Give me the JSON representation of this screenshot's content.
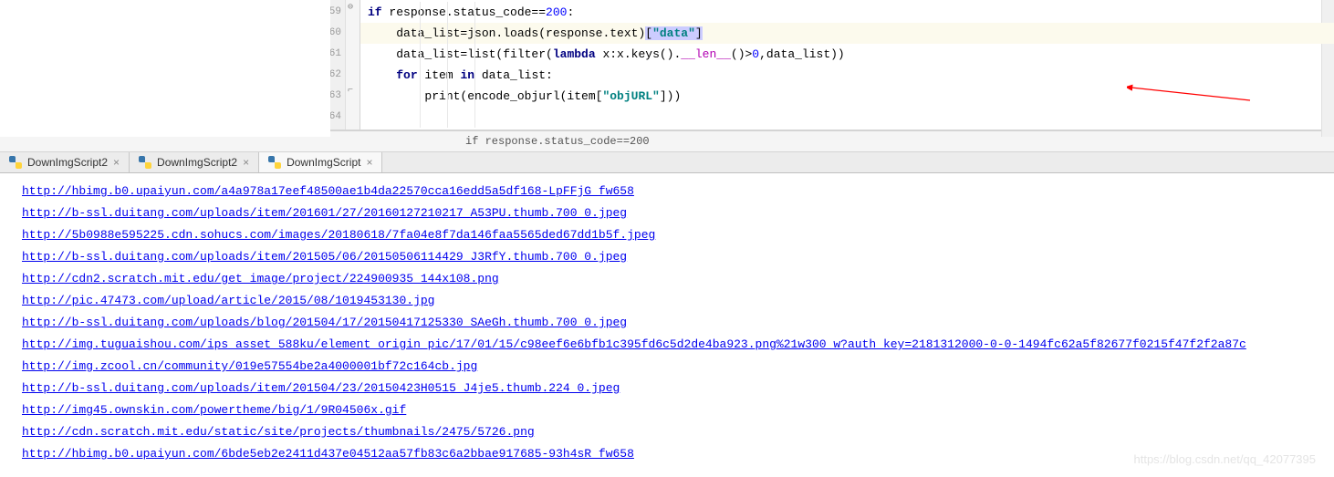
{
  "editor": {
    "lines": [
      {
        "num": "59",
        "type": "code",
        "segments": [
          {
            "t": "if",
            "c": "kw"
          },
          {
            "t": " response.status_code=="
          },
          {
            "t": "200",
            "c": "num"
          },
          {
            "t": ":"
          }
        ],
        "indent": 0
      },
      {
        "num": "60",
        "type": "code",
        "highlight": true,
        "segments": [
          {
            "t": "    data_list=json.loads(response.text)"
          },
          {
            "t": "[",
            "c": "sel"
          },
          {
            "t": "\"data\"",
            "c": "str sel"
          },
          {
            "t": "]",
            "c": "sel"
          }
        ],
        "indent": 0
      },
      {
        "num": "61",
        "type": "code",
        "segments": [
          {
            "t": "    data_list=list(filter("
          },
          {
            "t": "lambda",
            "c": "kw"
          },
          {
            "t": " x:x.keys()."
          },
          {
            "t": "__len__",
            "c": "dunder"
          },
          {
            "t": "()>"
          },
          {
            "t": "0",
            "c": "num"
          },
          {
            "t": ",data_list))"
          }
        ],
        "indent": 0
      },
      {
        "num": "62",
        "type": "code",
        "segments": [
          {
            "t": "    "
          },
          {
            "t": "for",
            "c": "kw"
          },
          {
            "t": " item "
          },
          {
            "t": "in",
            "c": "kw"
          },
          {
            "t": " data_list:"
          }
        ],
        "indent": 0
      },
      {
        "num": "63",
        "type": "code",
        "segments": [
          {
            "t": "        print(encode_objurl(item["
          },
          {
            "t": "\"objURL\"",
            "c": "str"
          },
          {
            "t": "]))"
          }
        ],
        "indent": 0
      },
      {
        "num": "64",
        "type": "code",
        "segments": [
          {
            "t": ""
          }
        ],
        "indent": 0
      }
    ]
  },
  "breadcrumb": "if response.status_code==200",
  "tabs": [
    {
      "label": "DownImgScript2",
      "active": false,
      "closable": true
    },
    {
      "label": "DownImgScript2",
      "active": false,
      "closable": true
    },
    {
      "label": "DownImgScript",
      "active": true,
      "closable": true
    }
  ],
  "output_urls": [
    "http://hbimg.b0.upaiyun.com/a4a978a17eef48500ae1b4da22570cca16edd5a5df168-LpFFjG_fw658",
    "http://b-ssl.duitang.com/uploads/item/201601/27/20160127210217_A53PU.thumb.700_0.jpeg",
    "http://5b0988e595225.cdn.sohucs.com/images/20180618/7fa04e8f7da146faa5565ded67dd1b5f.jpeg",
    "http://b-ssl.duitang.com/uploads/item/201505/06/20150506114429_J3RfY.thumb.700_0.jpeg",
    "http://cdn2.scratch.mit.edu/get_image/project/224900935_144x108.png",
    "http://pic.47473.com/upload/article/2015/08/1019453130.jpg",
    "http://b-ssl.duitang.com/uploads/blog/201504/17/20150417125330_SAeGh.thumb.700_0.jpeg",
    "http://img.tuguaishou.com/ips_asset_588ku/element_origin_pic/17/01/15/c98eef6e6bfb1c395fd6c5d2de4ba923.png%21w300_w?auth_key=2181312000-0-0-1494fc62a5f82677f0215f47f2f2a87c",
    "http://img.zcool.cn/community/019e57554be2a4000001bf72c164cb.jpg",
    "http://b-ssl.duitang.com/uploads/item/201504/23/20150423H0515_J4je5.thumb.224_0.jpeg",
    "http://img45.ownskin.com/powertheme/big/1/9R04506x.gif",
    "http://cdn.scratch.mit.edu/static/site/projects/thumbnails/2475/5726.png",
    "http://hbimg.b0.upaiyun.com/6bde5eb2e2411d437e04512aa57fb83c6a2bbae917685-93h4sR_fw658"
  ],
  "watermark": "https://blog.csdn.net/qq_42077395"
}
